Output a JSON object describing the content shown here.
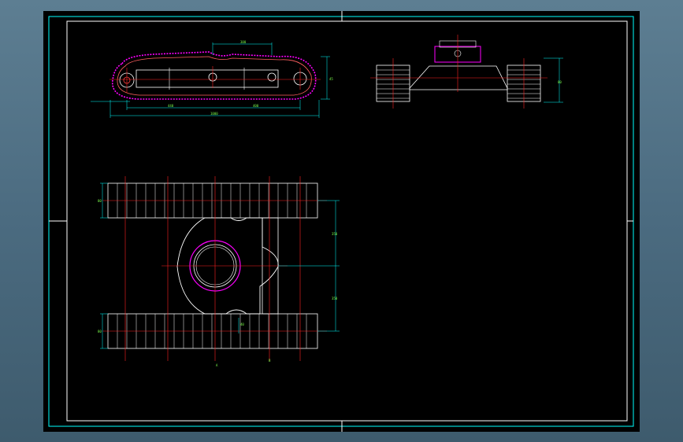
{
  "drawing": {
    "title": "",
    "dimensions": {
      "top_span": "300",
      "side_height": "45",
      "overall_length": "1000",
      "wheelbase_left": "440",
      "wheelbase_right": "400",
      "front_height": "80",
      "plan_track_width": "80",
      "plan_gap_upper": "350",
      "plan_gap_lower": "350",
      "plan_track_width_lower": "80",
      "plan_small": "40",
      "plan_bottom_a": "A",
      "plan_bottom_b": "B"
    }
  },
  "colors": {
    "background": "#000000",
    "frame": "#00ffff",
    "outline": "#ffffff",
    "centerline": "#ff2020",
    "dimension": "#7cff4c",
    "highlight": "#ff00ff"
  }
}
